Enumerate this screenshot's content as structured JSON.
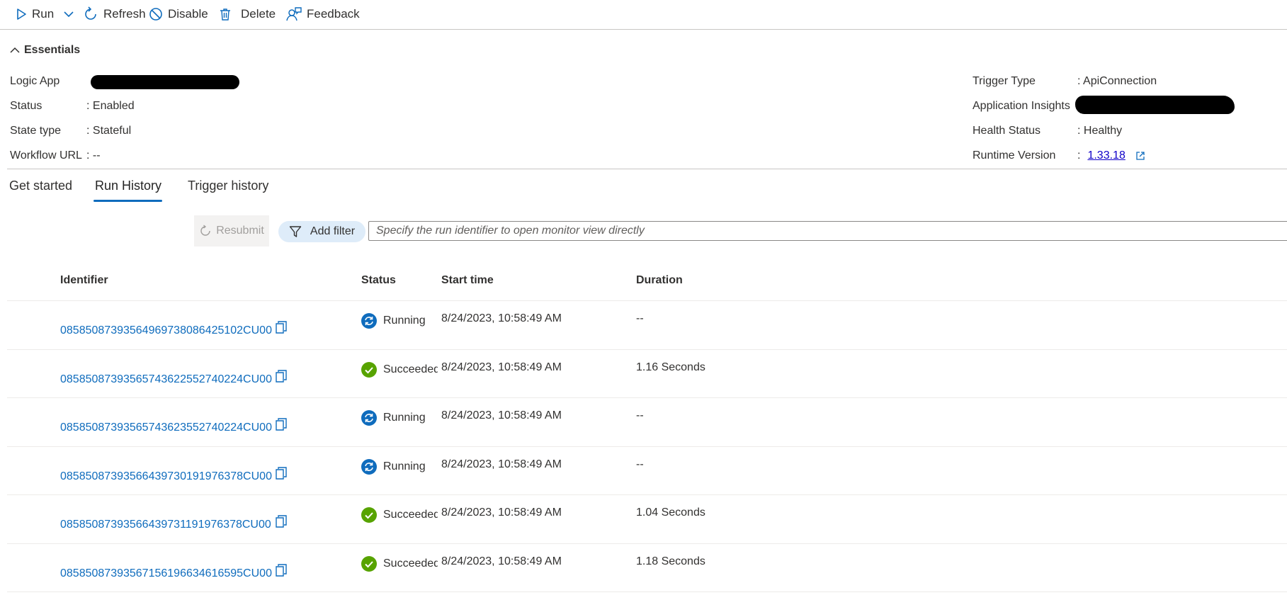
{
  "toolbar": {
    "run": "Run",
    "refresh": "Refresh",
    "disable": "Disable",
    "delete": "Delete",
    "feedback": "Feedback"
  },
  "essentials": {
    "title": "Essentials",
    "left": [
      {
        "label": "Logic App",
        "value": ""
      },
      {
        "label": "Status",
        "value": "Enabled"
      },
      {
        "label": "State type",
        "value": "Stateful"
      },
      {
        "label": "Workflow URL",
        "value": "--"
      }
    ],
    "right": [
      {
        "label": "Trigger Type",
        "value": "ApiConnection"
      },
      {
        "label": "Application Insights",
        "value": ""
      },
      {
        "label": "Health Status",
        "value": "Healthy"
      },
      {
        "label": "Runtime Version",
        "value": "1.33.18"
      }
    ]
  },
  "tabs": [
    {
      "label": "Get started"
    },
    {
      "label": "Run History"
    },
    {
      "label": "Trigger history"
    }
  ],
  "filters": {
    "resubmit": "Resubmit",
    "add_filter": "Add filter",
    "search_placeholder": "Specify the run identifier to open monitor view directly"
  },
  "table": {
    "headers": {
      "identifier": "Identifier",
      "status": "Status",
      "start_time": "Start time",
      "duration": "Duration"
    },
    "rows": [
      {
        "id": "08585087393564969738086425102CU00",
        "status": "Running",
        "start": "8/24/2023, 10:58:49 AM",
        "duration": "--"
      },
      {
        "id": "08585087393565743622552740224CU00",
        "status": "Succeeded",
        "start": "8/24/2023, 10:58:49 AM",
        "duration": "1.16 Seconds"
      },
      {
        "id": "08585087393565743623552740224CU00",
        "status": "Running",
        "start": "8/24/2023, 10:58:49 AM",
        "duration": "--"
      },
      {
        "id": "08585087393566439730191976378CU00",
        "status": "Running",
        "start": "8/24/2023, 10:58:49 AM",
        "duration": "--"
      },
      {
        "id": "08585087393566439731191976378CU00",
        "status": "Succeeded",
        "start": "8/24/2023, 10:58:49 AM",
        "duration": "1.04 Seconds"
      },
      {
        "id": "08585087393567156196634616595CU00",
        "status": "Succeeded",
        "start": "8/24/2023, 10:58:49 AM",
        "duration": "1.18 Seconds"
      }
    ]
  },
  "colors": {
    "accent": "#0f6cbd",
    "running": "#0f6cbd",
    "succeeded": "#57a300"
  }
}
